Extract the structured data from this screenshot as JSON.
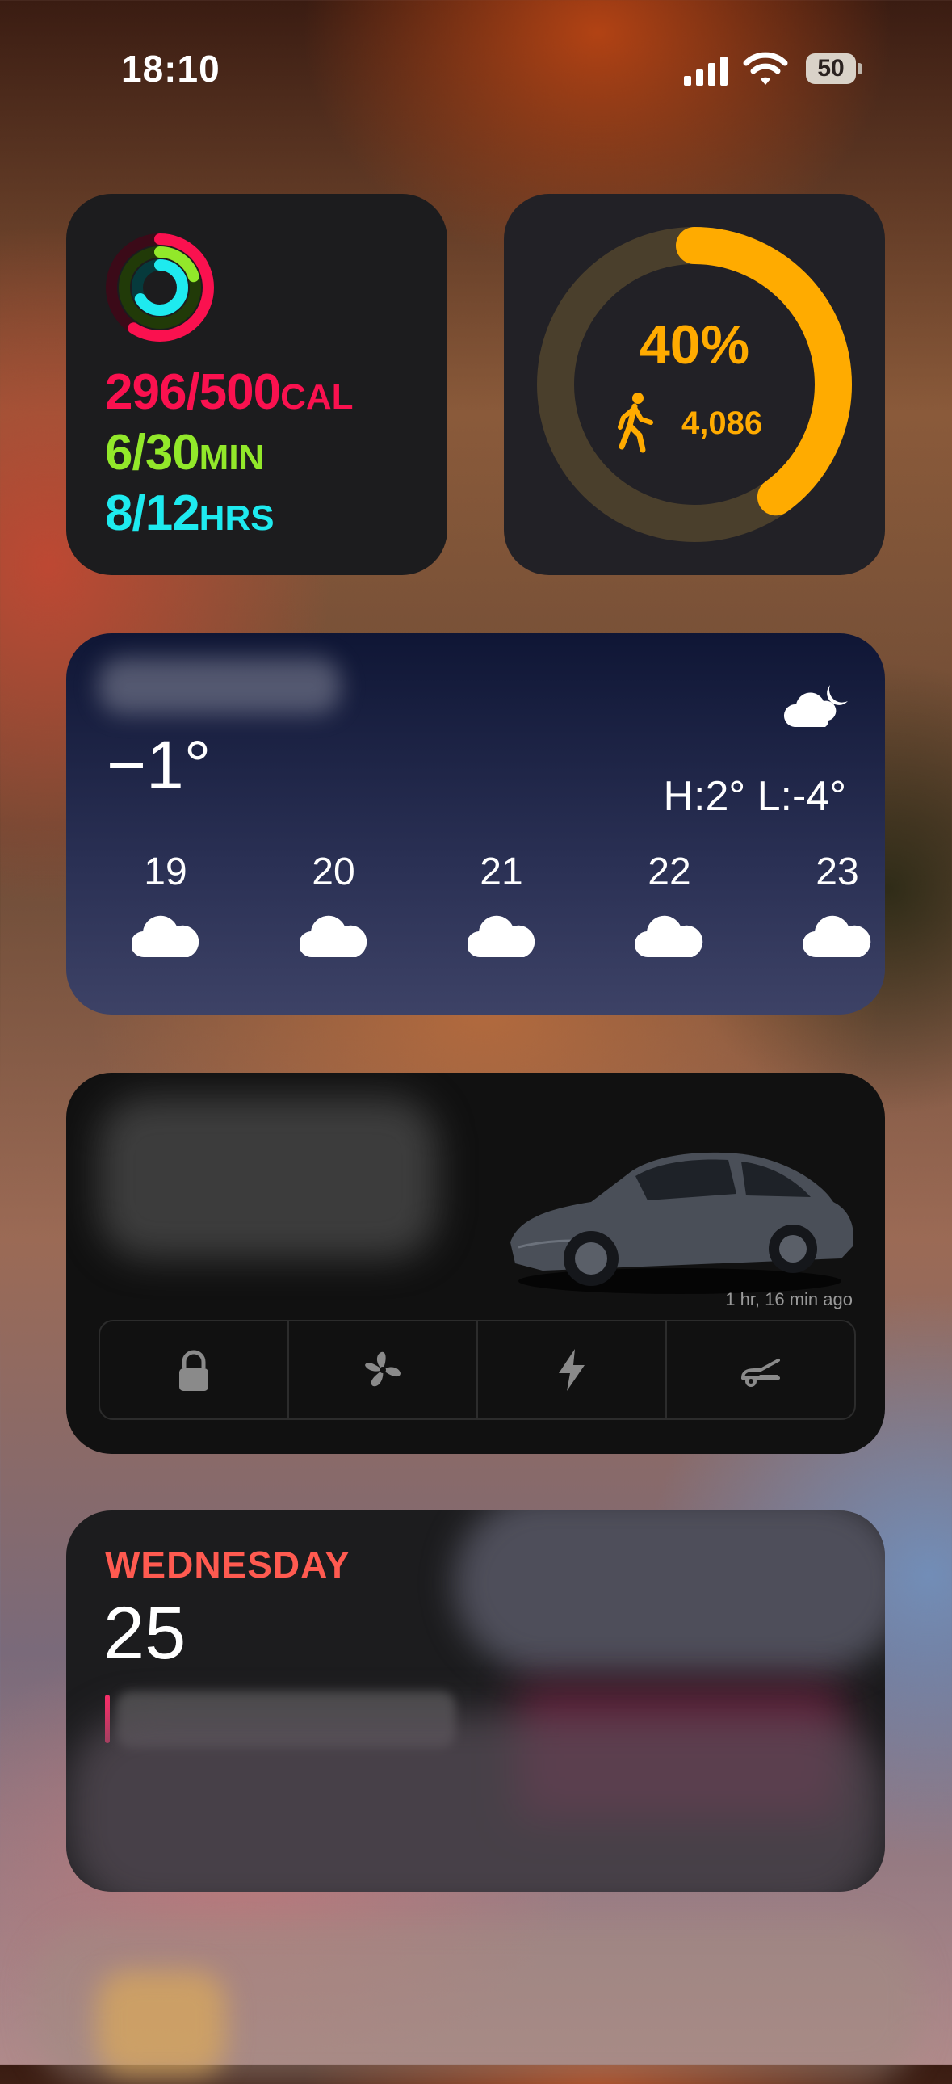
{
  "status_bar": {
    "time": "18:10",
    "battery": "50"
  },
  "activity": {
    "move": "296/500",
    "move_unit": "CAL",
    "exercise": "6/30",
    "exercise_unit": "MIN",
    "stand": "8/12",
    "stand_unit": "HRS",
    "colors": {
      "move": "#fa114f",
      "exercise": "#92e82a",
      "stand": "#1eeaef"
    }
  },
  "steps": {
    "percent": "40%",
    "progress": 0.4,
    "count": "4,086",
    "color": "#ffab00"
  },
  "weather": {
    "temperature": "−1°",
    "high_low": "H:2° L:-4°",
    "forecast": [
      {
        "day": "19",
        "icon": "cloud-icon"
      },
      {
        "day": "20",
        "icon": "cloud-icon"
      },
      {
        "day": "21",
        "icon": "cloud-icon"
      },
      {
        "day": "22",
        "icon": "cloud-icon"
      },
      {
        "day": "23",
        "icon": "cloud-icon"
      }
    ]
  },
  "tesla": {
    "updated": "1 hr, 16 min ago",
    "controls": [
      "lock-icon",
      "fan-icon",
      "bolt-icon",
      "frunk-icon"
    ]
  },
  "calendar": {
    "weekday": "WEDNESDAY",
    "date": "25"
  }
}
